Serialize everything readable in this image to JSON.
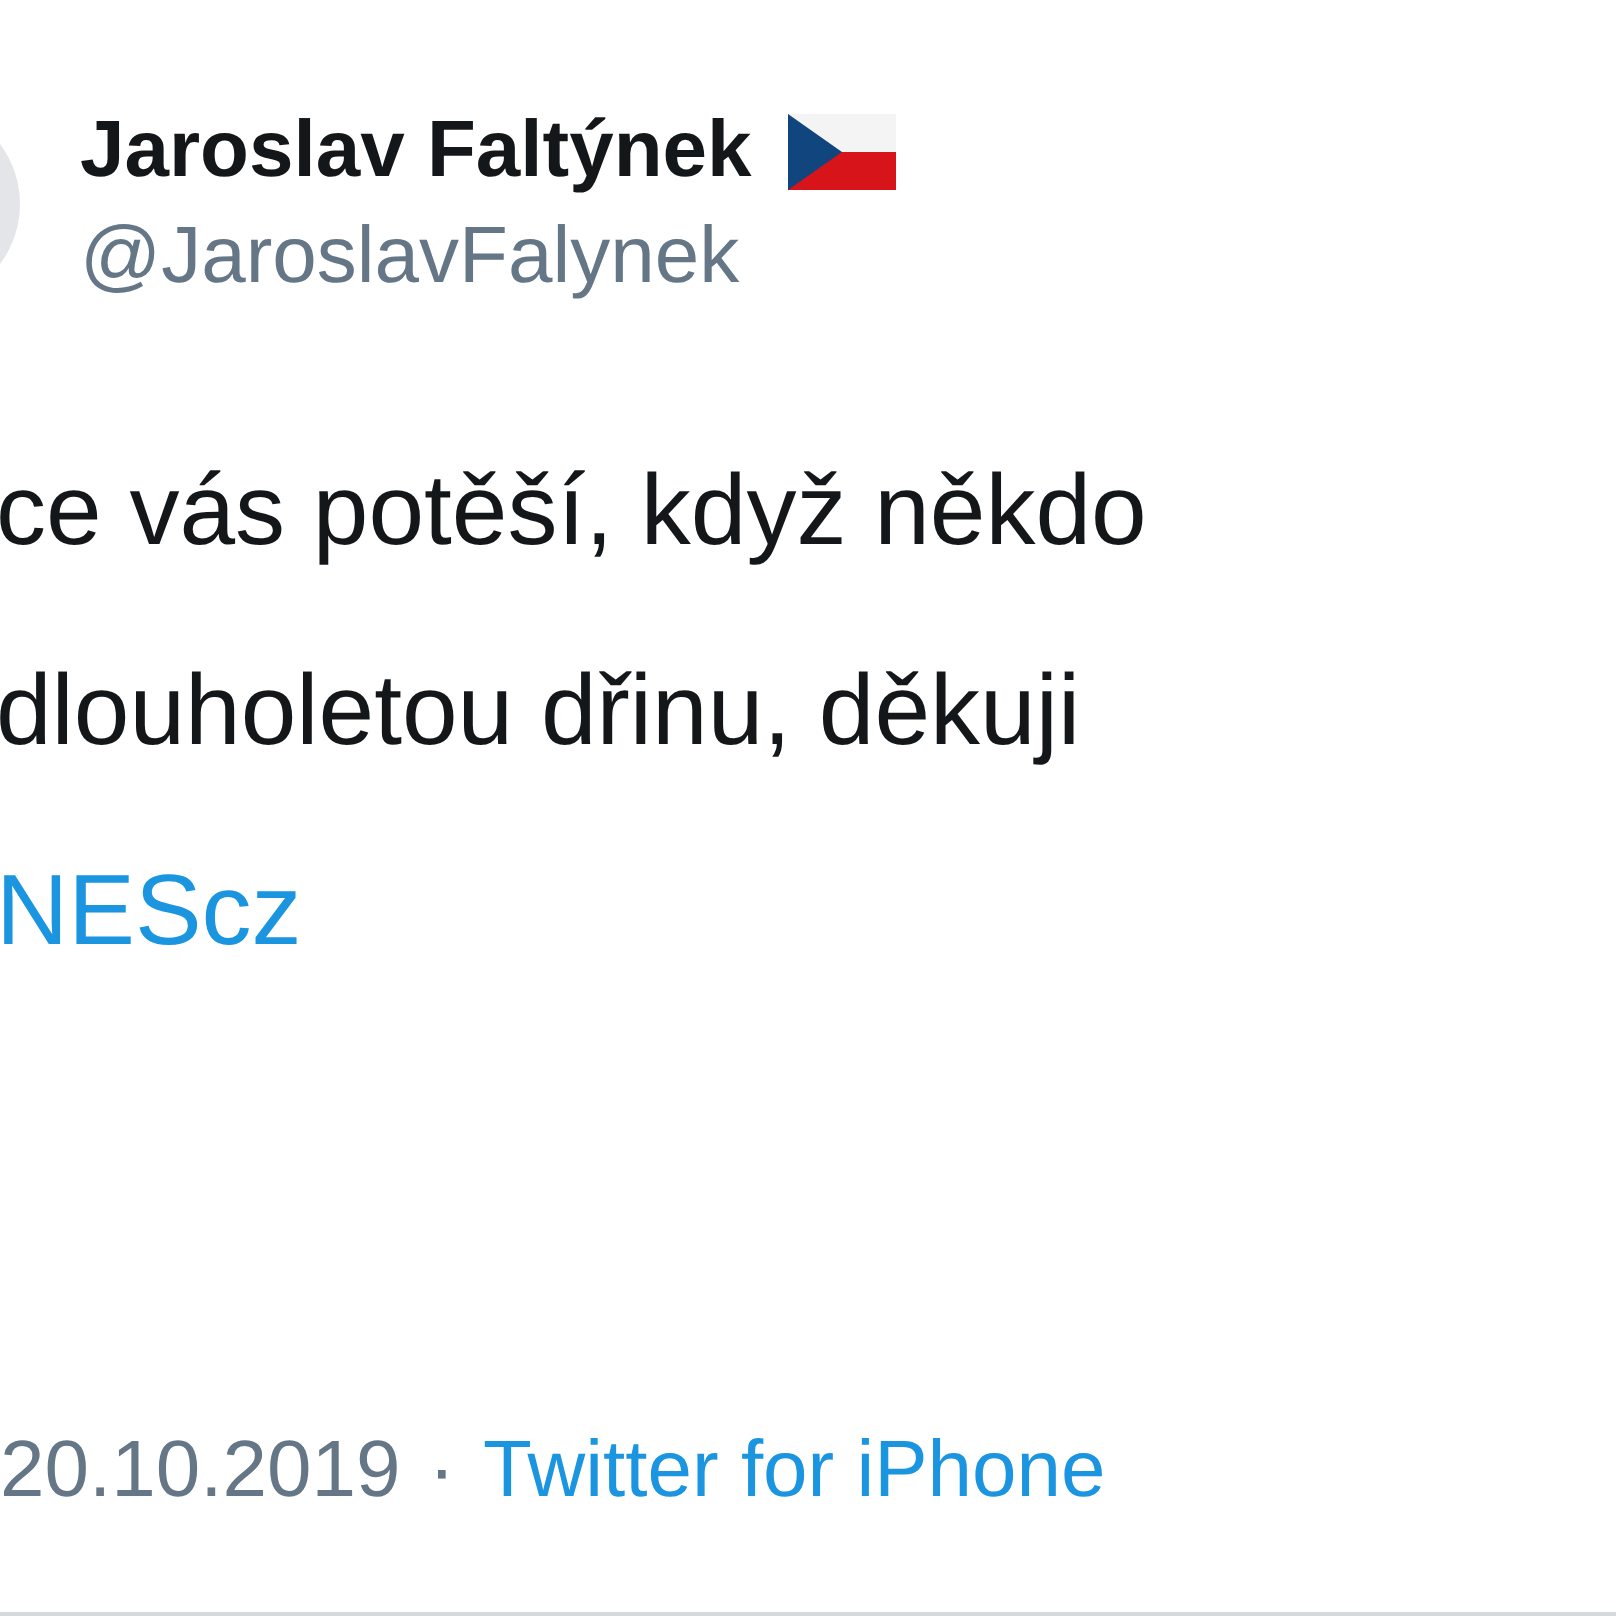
{
  "author": {
    "name": "Jaroslav Faltýnek",
    "handle": "@JaroslavFalynek"
  },
  "body_lines": [
    {
      "kind": "text",
      "text": "ce vás potěší, když někdo"
    },
    {
      "kind": "text",
      "text": "dlouholetou dřinu, děkuji"
    },
    {
      "kind": "link",
      "text": "NEScz"
    }
  ],
  "footer": {
    "date": "20.10.2019",
    "separator": "·",
    "source": "Twitter for iPhone"
  }
}
